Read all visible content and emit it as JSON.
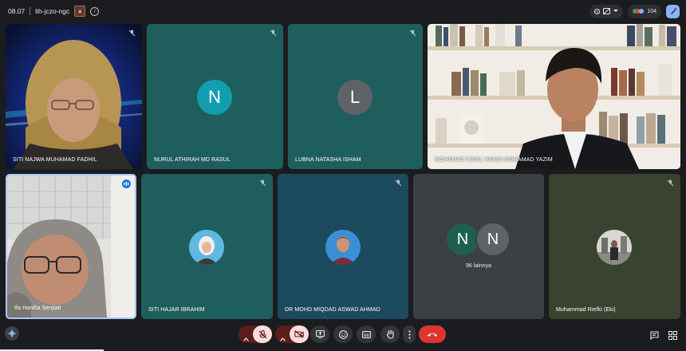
{
  "meeting": {
    "time": "08.07",
    "code": "lih-jczo-ngc",
    "participant_count": "104"
  },
  "tiles": [
    {
      "name": "SITI NAJWA MUHAMAD FADHIL",
      "type": "video"
    },
    {
      "name": "NURUL ATHIRAH MD RASUL",
      "type": "letter",
      "letter": "N",
      "avatar_color": "#129eaf"
    },
    {
      "name": "LUBNA NATASHA ISHAM",
      "type": "letter",
      "letter": "L",
      "avatar_color": "#5f6368"
    },
    {
      "name": "MOHAMAD IKMAL HAKIM MOHAMAD YAZIM",
      "type": "video"
    },
    {
      "name": "Ifa Hanifia Senjiati",
      "type": "video",
      "speaking": true
    },
    {
      "name": "SITI HAJAR IBRAHIM",
      "type": "photo"
    },
    {
      "name": "DR MOHD MIQDAD ASWAD AHMAD",
      "type": "photo"
    },
    {
      "name": "Muhammad Riefki (Eki)",
      "type": "photo"
    }
  ],
  "others": {
    "letters": [
      "N",
      "N"
    ],
    "label": "96 lainnya"
  },
  "colors": {
    "background": "#1b1c1f",
    "tile_teal": "#1e5f5e",
    "end_call": "#dc362e",
    "muted_button": "#f9dedc"
  }
}
